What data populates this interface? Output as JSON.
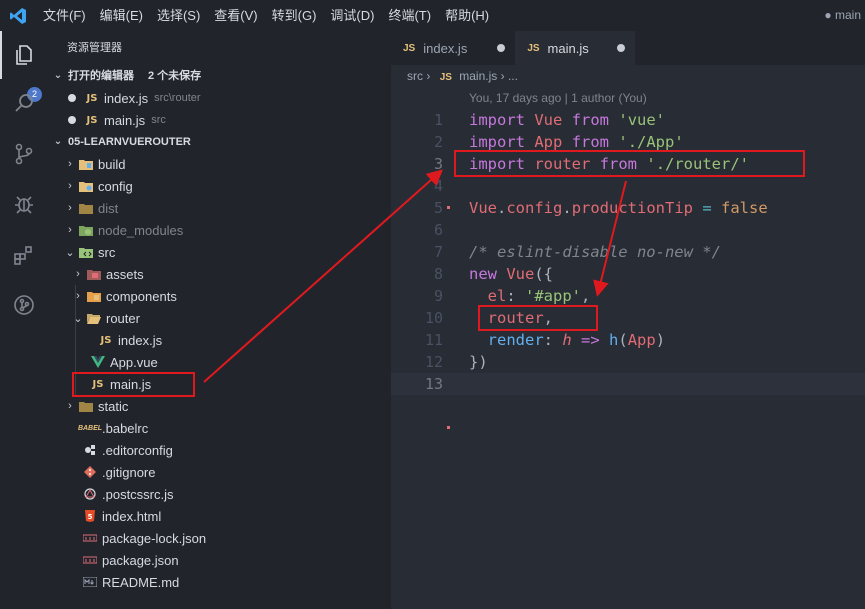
{
  "menu": {
    "items": [
      "文件(F)",
      "编辑(E)",
      "选择(S)",
      "查看(V)",
      "转到(G)",
      "调试(D)",
      "终端(T)",
      "帮助(H)"
    ],
    "window_title": "● main"
  },
  "activity": {
    "badge": "2"
  },
  "sidebar": {
    "title": "资源管理器",
    "open_editors": {
      "label": "打开的编辑器",
      "unsaved": "2 个未保存"
    },
    "open_files": [
      {
        "name": "index.js",
        "path": "src\\router"
      },
      {
        "name": "main.js",
        "path": "src"
      }
    ],
    "project": {
      "label": "05-LEARNVUEROUTER"
    },
    "tree": {
      "build": "build",
      "config": "config",
      "dist": "dist",
      "node_modules": "node_modules",
      "src": "src",
      "assets": "assets",
      "components": "components",
      "router": "router",
      "router_index": "index.js",
      "app_vue": "App.vue",
      "main_js": "main.js",
      "static": "static",
      "babelrc": ".babelrc",
      "editorconfig": ".editorconfig",
      "gitignore": ".gitignore",
      "postcssrc": ".postcssrc.js",
      "index_html": "index.html",
      "package_lock": "package-lock.json",
      "package_json": "package.json",
      "readme": "README.md"
    }
  },
  "tabs": [
    {
      "label": "index.js"
    },
    {
      "label": "main.js"
    }
  ],
  "breadcrumbs": {
    "folder": "src",
    "file": "main.js",
    "more": "..."
  },
  "codelens": "You, 17 days ago | 1 author (You)",
  "code": {
    "l1": {
      "kw": "import",
      "name": "Vue",
      "from": "from",
      "str": "'vue'"
    },
    "l2": {
      "kw": "import",
      "name": "App",
      "from": "from",
      "str": "'./App'"
    },
    "l3": {
      "kw": "import",
      "name": "router",
      "from": "from",
      "str": "'./router/'"
    },
    "l5": {
      "obj": "Vue",
      "dot1": ".",
      "prop": "config",
      "dot2": ".",
      "prop2": "productionTip",
      "eq": " = ",
      "val": "false"
    },
    "l7": {
      "comment": "/* eslint-disable no-new */"
    },
    "l8": {
      "kw": "new",
      "cls": "Vue",
      "open": "({"
    },
    "l9": {
      "key": "el",
      "colon": ": ",
      "str": "'#app'",
      "comma": ","
    },
    "l10": {
      "key": "router",
      "comma": ","
    },
    "l11": {
      "key": "render",
      "colon": ": ",
      "arg": "h",
      "arrow": " => ",
      "fn": "h",
      "paren": "(",
      "argv": "App",
      "close": ")"
    },
    "l12": {
      "close": "})"
    }
  },
  "line_numbers": [
    "1",
    "2",
    "3",
    "4",
    "5",
    "6",
    "7",
    "8",
    "9",
    "10",
    "11",
    "12",
    "13"
  ]
}
